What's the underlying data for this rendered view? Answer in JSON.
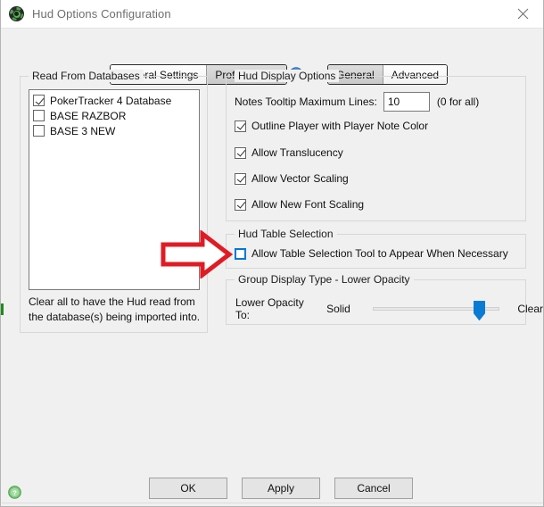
{
  "window": {
    "title": "Hud Options Configuration",
    "icon": "pokertracker-green-icon",
    "close_label": "✕"
  },
  "tabstrip": {
    "left_group": [
      {
        "label": "General Settings",
        "pressed": false
      },
      {
        "label": "Profile Select",
        "pressed": true
      }
    ],
    "help_icon": "help-circle-icon",
    "right_group": [
      {
        "label": "General",
        "pressed": true
      },
      {
        "label": "Advanced",
        "pressed": false
      }
    ]
  },
  "read_from_databases": {
    "title": "Read From Databases",
    "items": [
      {
        "label": "PokerTracker 4 Database",
        "checked": true
      },
      {
        "label": "BASE RAZBOR",
        "checked": false
      },
      {
        "label": "BASE 3 NEW",
        "checked": false
      }
    ],
    "note_line1": "Clear all to have the Hud read from",
    "note_line2": "the database(s) being imported into."
  },
  "hud_display_options": {
    "title": "Hud Display Options",
    "notes_tooltip_label": "Notes Tooltip Maximum Lines:",
    "notes_tooltip_value": "10",
    "notes_tooltip_hint": "(0 for all)",
    "checkboxes": [
      {
        "label": "Outline Player with Player Note Color",
        "checked": true
      },
      {
        "label": "Allow Translucency",
        "checked": true
      },
      {
        "label": "Allow Vector Scaling",
        "checked": true
      },
      {
        "label": "Allow New Font Scaling",
        "checked": true
      }
    ]
  },
  "hud_table_selection": {
    "title": "Hud Table Selection",
    "checkbox": {
      "label": "Allow Table Selection Tool to Appear When Necessary",
      "checked": false,
      "focused": true
    }
  },
  "group_display_type": {
    "title": "Group Display Type - Lower Opacity",
    "slider_label": "Lower Opacity To:",
    "min_label": "Solid",
    "max_label": "Clear",
    "value_percent": 80
  },
  "annotation": {
    "arrow": "red-right-arrow",
    "color": "#e01b24"
  },
  "footer": {
    "help_icon": "help-circle-green-icon",
    "buttons": [
      {
        "label": "OK"
      },
      {
        "label": "Apply"
      },
      {
        "label": "Cancel"
      }
    ]
  },
  "colors": {
    "window_bg": "#f0f0f0",
    "titlebar_bg": "#ffffff",
    "accent_blue": "#0078d7",
    "annotation_red": "#e01b24",
    "green_icon": "#4db84d"
  }
}
